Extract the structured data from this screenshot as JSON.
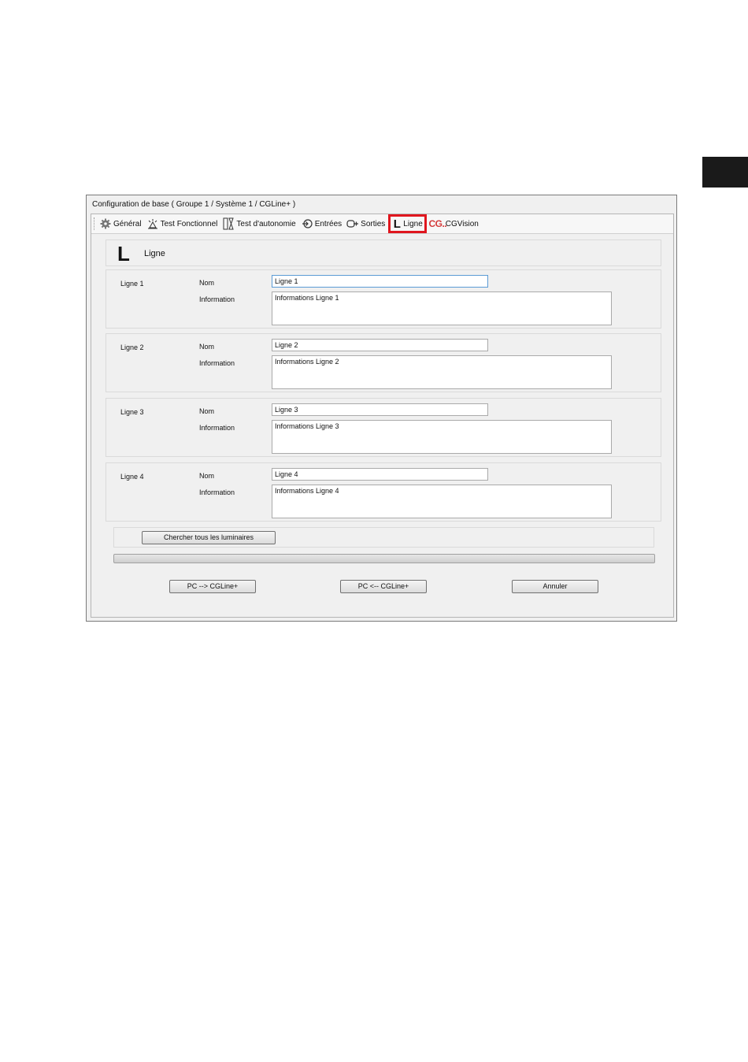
{
  "window": {
    "title": "Configuration de base ( Groupe 1 / Système 1 / CGLine+ )"
  },
  "toolbar": {
    "items": [
      {
        "label": "Général",
        "icon": "gear-icon"
      },
      {
        "label": "Test Fonctionnel",
        "icon": "lamp-icon"
      },
      {
        "label": "Test d'autonomie",
        "icon": "hourglass-icon"
      },
      {
        "label": "Entrées",
        "icon": "input-icon"
      },
      {
        "label": "Sorties",
        "icon": "output-icon"
      },
      {
        "label": "Ligne",
        "icon": "line-l-icon",
        "selected": true
      },
      {
        "label": "CGVision",
        "icon": "cg-logo-icon"
      }
    ],
    "selected_color": "#e0161e"
  },
  "header": {
    "icon_text": "L",
    "title": "Ligne"
  },
  "lines": [
    {
      "label": "Ligne 1",
      "nom_label": "Nom",
      "info_label": "Information",
      "nom_value": "Ligne 1",
      "info_value": "Informations Ligne 1"
    },
    {
      "label": "Ligne 2",
      "nom_label": "Nom",
      "info_label": "Information",
      "nom_value": "Ligne 2",
      "info_value": "Informations Ligne 2"
    },
    {
      "label": "Ligne 3",
      "nom_label": "Nom",
      "info_label": "Information",
      "nom_value": "Ligne 3",
      "info_value": "Informations Ligne 3"
    },
    {
      "label": "Ligne 4",
      "nom_label": "Nom",
      "info_label": "Information",
      "nom_value": "Ligne 4",
      "info_value": "Informations Ligne 4"
    }
  ],
  "search_button": "Chercher tous les luminaires",
  "progress": {
    "value": 0
  },
  "actions": {
    "upload": "PC --> CGLine+",
    "download": "PC <-- CGLine+",
    "cancel": "Annuler"
  }
}
